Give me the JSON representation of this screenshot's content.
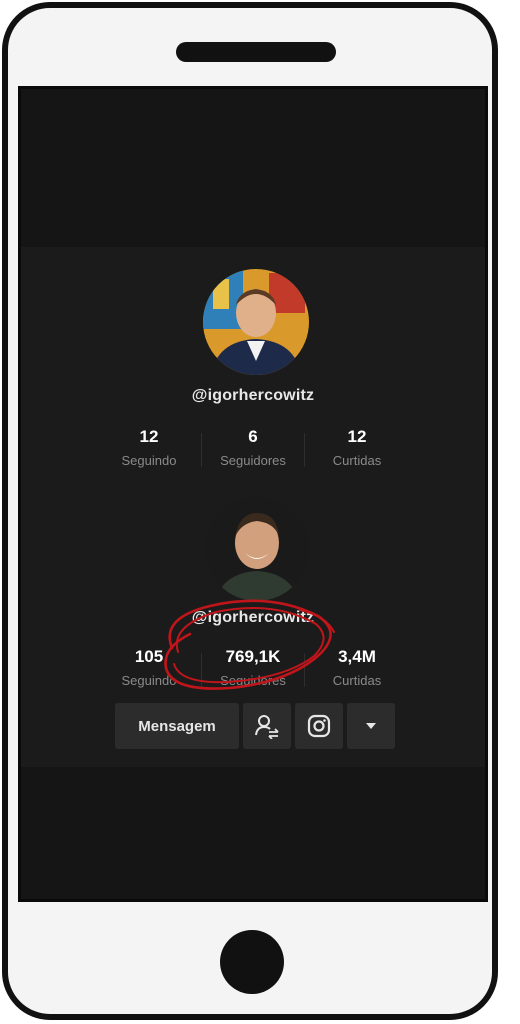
{
  "profile_small": {
    "username": "@igorhercowitz",
    "stats": [
      {
        "value": "12",
        "label": "Seguindo"
      },
      {
        "value": "6",
        "label": "Seguidores"
      },
      {
        "value": "12",
        "label": "Curtidas"
      }
    ]
  },
  "profile_large": {
    "username": "@igorhercowitz",
    "stats": [
      {
        "value": "105",
        "label": "Seguindo"
      },
      {
        "value": "769,1K",
        "label": "Seguidores"
      },
      {
        "value": "3,4M",
        "label": "Curtidas"
      }
    ]
  },
  "actions": {
    "message_label": "Mensagem",
    "icons": [
      "add-friend-icon",
      "instagram-icon",
      "caret-down-icon"
    ]
  },
  "colors": {
    "screen_bg": "#151515",
    "panel_bg": "#1b1b1b",
    "button_bg": "#2c2c2c",
    "highlight": "#c0151a"
  }
}
